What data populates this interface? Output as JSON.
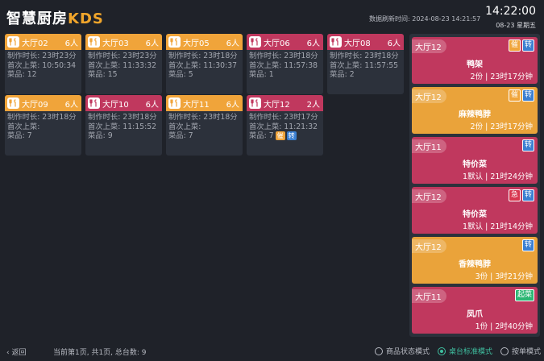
{
  "header": {
    "logo_main": "智慧厨房",
    "logo_accent": "KDS",
    "refresh": "数据刷新时间: 2024-08-23 14:21:57",
    "clock": "14:22:00",
    "date": "08-23 星期五"
  },
  "labels": {
    "duration": "制作时长: ",
    "first_serve": "首次上菜: ",
    "dishes": "菜品: "
  },
  "cards": [
    {
      "hall": "大厅02",
      "people": "6人",
      "color": "orange",
      "duration": "23时23分",
      "first": "10:50:34",
      "dishes": "12",
      "tags": []
    },
    {
      "hall": "大厅03",
      "people": "6人",
      "color": "orange",
      "duration": "23时23分",
      "first": "11:33:32",
      "dishes": "15",
      "tags": []
    },
    {
      "hall": "大厅05",
      "people": "6人",
      "color": "orange",
      "duration": "23时18分",
      "first": "11:30:37",
      "dishes": "5",
      "tags": []
    },
    {
      "hall": "大厅06",
      "people": "6人",
      "color": "pink",
      "duration": "23时18分",
      "first": "11:57:38",
      "dishes": "1",
      "tags": []
    },
    {
      "hall": "大厅08",
      "people": "6人",
      "color": "pink",
      "duration": "23时18分",
      "first": "11:57:55",
      "dishes": "2",
      "tags": []
    },
    {
      "hall": "大厅09",
      "people": "6人",
      "color": "orange",
      "duration": "23时18分",
      "first": "",
      "dishes": "7",
      "tags": []
    },
    {
      "hall": "大厅10",
      "people": "6人",
      "color": "pink",
      "duration": "23时18分",
      "first": "11:15:52",
      "dishes": "9",
      "tags": []
    },
    {
      "hall": "大厅11",
      "people": "6人",
      "color": "orange",
      "duration": "23时18分",
      "first": "",
      "dishes": "7",
      "tags": []
    },
    {
      "hall": "大厅12",
      "people": "2人",
      "color": "pink",
      "duration": "23时17分",
      "first": "11:21:32",
      "dishes": "7",
      "tags": [
        "催",
        "转"
      ]
    }
  ],
  "tickets": [
    {
      "hall": "大厅12",
      "dish": "鸭架",
      "info": "2份 | 23时17分钟",
      "color": "pink",
      "tags": [
        {
          "t": "催",
          "k": "urge"
        },
        {
          "t": "转",
          "k": "transfer"
        }
      ]
    },
    {
      "hall": "大厅12",
      "dish": "麻辣鸭脖",
      "info": "2份 | 23时17分钟",
      "color": "orange",
      "tags": [
        {
          "t": "催",
          "k": "urge"
        },
        {
          "t": "转",
          "k": "transfer"
        }
      ]
    },
    {
      "hall": "大厅11",
      "dish": "特价菜",
      "info": "1默认 | 21时24分钟",
      "color": "pink",
      "tags": [
        {
          "t": "转",
          "k": "transfer"
        }
      ]
    },
    {
      "hall": "大厅12",
      "dish": "特价菜",
      "info": "1默认 | 21时14分钟",
      "color": "pink",
      "tags": [
        {
          "t": "急",
          "k": "hurry"
        },
        {
          "t": "转",
          "k": "transfer"
        }
      ]
    },
    {
      "hall": "大厅12",
      "dish": "香辣鸭脖",
      "info": "3份 | 3时21分钟",
      "color": "orange",
      "tags": [
        {
          "t": "转",
          "k": "transfer"
        }
      ]
    },
    {
      "hall": "大厅11",
      "dish": "凤爪",
      "info": "1份 | 2时40分钟",
      "color": "pink",
      "tags": [
        {
          "t": "起菜",
          "k": "start"
        }
      ]
    }
  ],
  "footer": {
    "back": "返回",
    "page_info": "当前第1页, 共1页, 总台数: 9",
    "modes": [
      {
        "label": "商品状态模式",
        "active": false
      },
      {
        "label": "桌台标准模式",
        "active": true
      },
      {
        "label": "按单模式",
        "active": false
      }
    ]
  }
}
